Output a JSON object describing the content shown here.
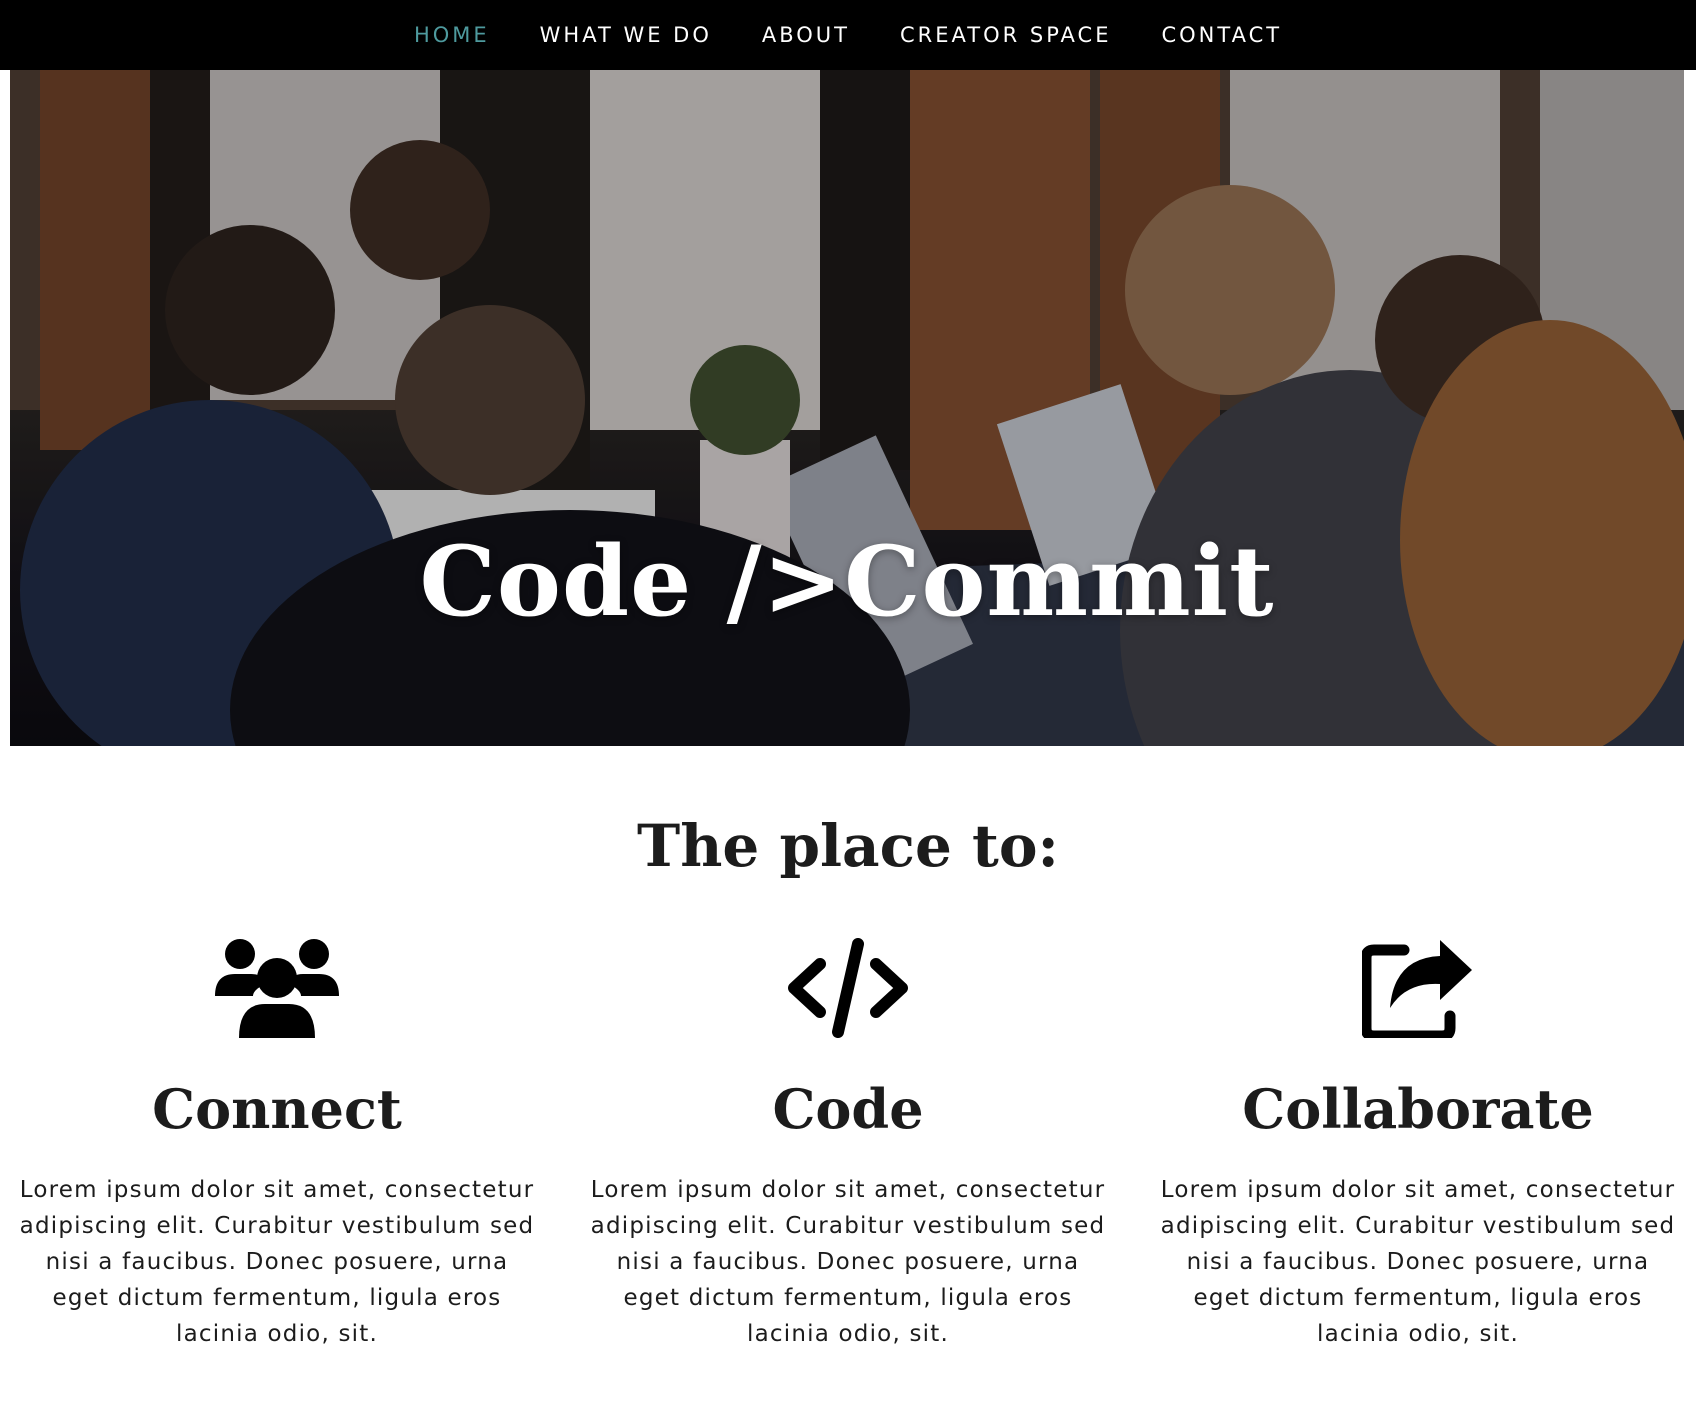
{
  "nav": {
    "items": [
      {
        "label": "HOME",
        "active": true
      },
      {
        "label": "WHAT WE DO",
        "active": false
      },
      {
        "label": "ABOUT",
        "active": false
      },
      {
        "label": "CREATOR SPACE",
        "active": false
      },
      {
        "label": "CONTACT",
        "active": false
      }
    ],
    "active_color": "#4e9a9e"
  },
  "hero": {
    "title": "Code />Commit",
    "image": "people-coding-at-table-photo"
  },
  "features": {
    "heading": "The place to:",
    "items": [
      {
        "icon": "users-group-icon",
        "title": "Connect",
        "text": "Lorem ipsum dolor sit amet, consectetur adipiscing elit. Curabitur vestibulum sed nisi a faucibus. Donec posuere, urna eget dictum fermentum, ligula eros lacinia odio, sit."
      },
      {
        "icon": "code-icon",
        "title": "Code",
        "text": "Lorem ipsum dolor sit amet, consectetur adipiscing elit. Curabitur vestibulum sed nisi a faucibus. Donec posuere, urna eget dictum fermentum, ligula eros lacinia odio, sit."
      },
      {
        "icon": "share-icon",
        "title": "Collaborate",
        "text": "Lorem ipsum dolor sit amet, consectetur adipiscing elit. Curabitur vestibulum sed nisi a faucibus. Donec posuere, urna eget dictum fermentum, ligula eros lacinia odio, sit."
      }
    ]
  }
}
